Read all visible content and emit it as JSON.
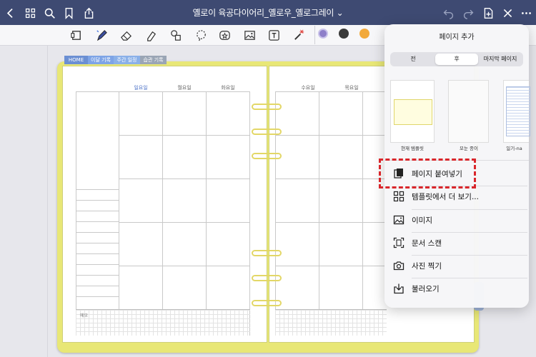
{
  "topbar": {
    "title": "옐로이 육공다이어리_옐로우_옐로그레이 ⌄",
    "icons": [
      "back-icon",
      "grid-icon",
      "search-icon",
      "bookmark-icon",
      "share-icon",
      "undo-icon",
      "redo-icon",
      "add-page-icon",
      "close-icon",
      "more-icon"
    ]
  },
  "toolbar": {
    "tools": [
      "page-layout-icon",
      "pen-icon",
      "eraser-icon",
      "highlighter-icon",
      "shapes-icon",
      "lasso-icon",
      "sticker-icon",
      "image-icon",
      "text-icon",
      "laser-icon"
    ],
    "colors": [
      "#8e7fc9",
      "#3a3a3a",
      "#f2a93b"
    ]
  },
  "planner": {
    "tabs": [
      "HOME",
      "이달 기록",
      "주간 일정",
      "습관 기록"
    ],
    "tab_colors": [
      "#6b8fd3",
      "#7ea4e6",
      "#8ab0e8",
      "#9aa5b5"
    ],
    "left_days": [
      "일요일",
      "월요일",
      "화요일"
    ],
    "right_days": [
      "수요일",
      "목요일"
    ],
    "memo_label": "메모"
  },
  "popover": {
    "title": "페이지 추가",
    "segments": [
      "전",
      "후",
      "마지막 페이지"
    ],
    "selected_segment": "후",
    "thumbnails": [
      "현재 템플릿",
      "모눈 종이",
      "일기-na"
    ],
    "items": [
      {
        "label": "페이지 붙여넣기",
        "icon": "paste-icon"
      },
      {
        "label": "템플릿에서 더 보기...",
        "icon": "template-grid-icon"
      },
      {
        "label": "이미지",
        "icon": "image-icon"
      },
      {
        "label": "문서 스캔",
        "icon": "scan-icon"
      },
      {
        "label": "사진 찍기",
        "icon": "camera-icon"
      },
      {
        "label": "불러오기",
        "icon": "import-icon"
      }
    ]
  }
}
